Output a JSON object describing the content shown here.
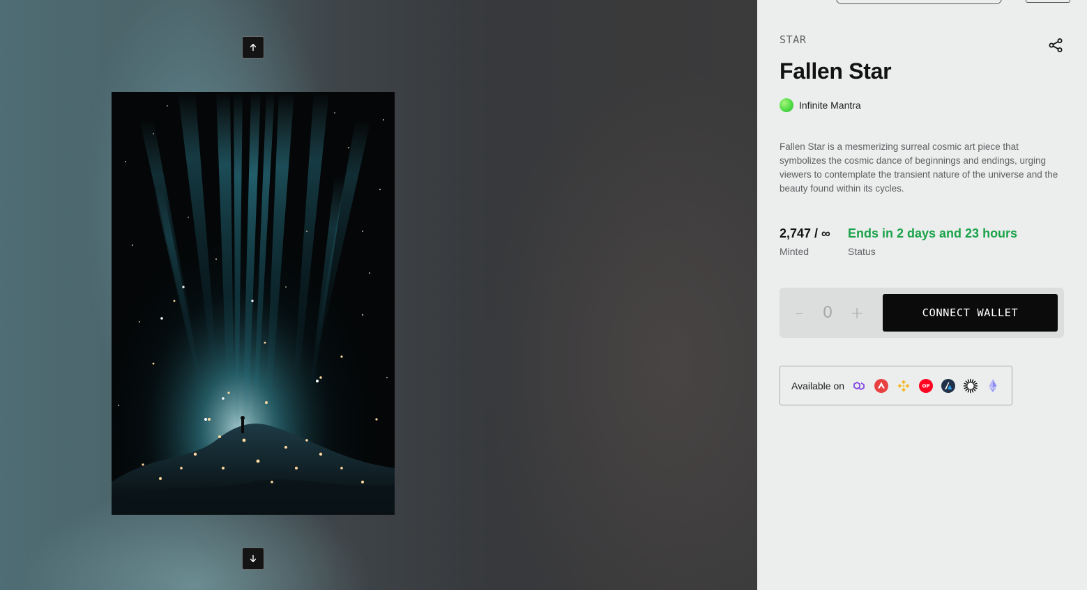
{
  "gallery": {
    "prev_icon": "arrow-up-icon",
    "next_icon": "arrow-down-icon",
    "artwork_name": "Fallen Star"
  },
  "product": {
    "category": "STAR",
    "title": "Fallen Star",
    "creator": "Infinite Mantra",
    "description": "Fallen Star is a mesmerizing surreal cosmic art piece that symbolizes the cosmic dance of beginnings and endings, urging viewers to contemplate the transient nature of the universe and the beauty found within its cycles.",
    "share_icon": "share-icon"
  },
  "stats": {
    "minted_value": "2,747 / ∞",
    "minted_label": "Minted",
    "status_value": "Ends in 2 days and 23 hours",
    "status_label": "Status",
    "status_color": "#1aa34a"
  },
  "mint": {
    "minus": "–",
    "quantity": "0",
    "plus": "+",
    "connect_label": "CONNECT WALLET"
  },
  "chains": {
    "label": "Available on",
    "items": [
      {
        "name": "polygon",
        "icon": "polygon-icon",
        "color": "#8247e5"
      },
      {
        "name": "avalanche",
        "icon": "avalanche-icon",
        "color": "#e84142"
      },
      {
        "name": "bnb",
        "icon": "bnb-icon",
        "color": "#f3ba2f"
      },
      {
        "name": "optimism",
        "icon": "optimism-icon",
        "color": "#ff0420"
      },
      {
        "name": "arbitrum",
        "icon": "arbitrum-icon",
        "color": "#213147"
      },
      {
        "name": "zora",
        "icon": "zora-icon",
        "color": "#111111"
      },
      {
        "name": "ethereum",
        "icon": "ethereum-icon",
        "color": "#8c8cf5"
      }
    ]
  }
}
